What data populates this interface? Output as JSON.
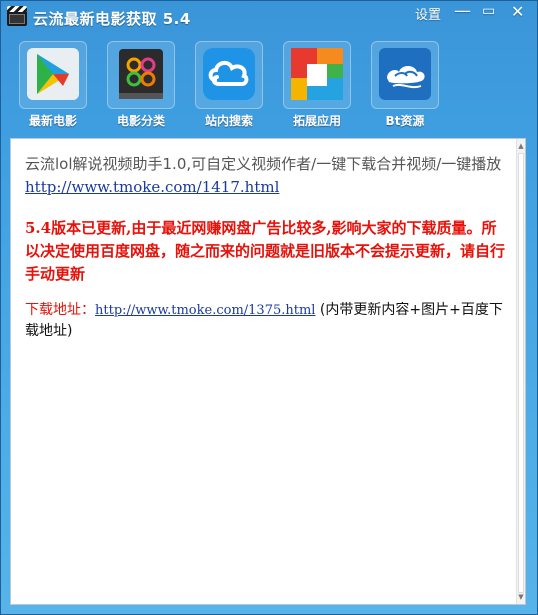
{
  "window": {
    "title": "云流最新电影获取  5.4",
    "settings_label": "设置",
    "minimize_glyph": "—",
    "restore_glyph": "▭",
    "close_glyph": "✕"
  },
  "toolbar": {
    "items": [
      {
        "label": "最新电影",
        "icon": "play-store-icon"
      },
      {
        "label": "电影分类",
        "icon": "categories-icon"
      },
      {
        "label": "站内搜索",
        "icon": "cloud-search-icon"
      },
      {
        "label": "拓展应用",
        "icon": "apps-extension-icon"
      },
      {
        "label": "Bt资源",
        "icon": "bt-cloud-icon"
      }
    ]
  },
  "content": {
    "para1_text": "云流lol解说视频助手1.0,可自定义视频作者/一键下载合并视频/一键播放 ",
    "para1_link": "http://www.tmoke.com/1417.html",
    "para2_text": "5.4版本已更新,由于最近网赚网盘广告比较多,影响大家的下载质量。所以决定使用百度网盘，随之而来的问题就是旧版本不会提示更新，请自行手动更新",
    "para3_label": "下载地址：",
    "para3_link": "http://www.tmoke.com/1375.html",
    "para3_suffix": " (内带更新内容+图片+百度下载地址)"
  },
  "colors": {
    "accent_red": "#e8110a",
    "link_blue": "#1a3a9e",
    "window_blue": "#3a95d8"
  }
}
